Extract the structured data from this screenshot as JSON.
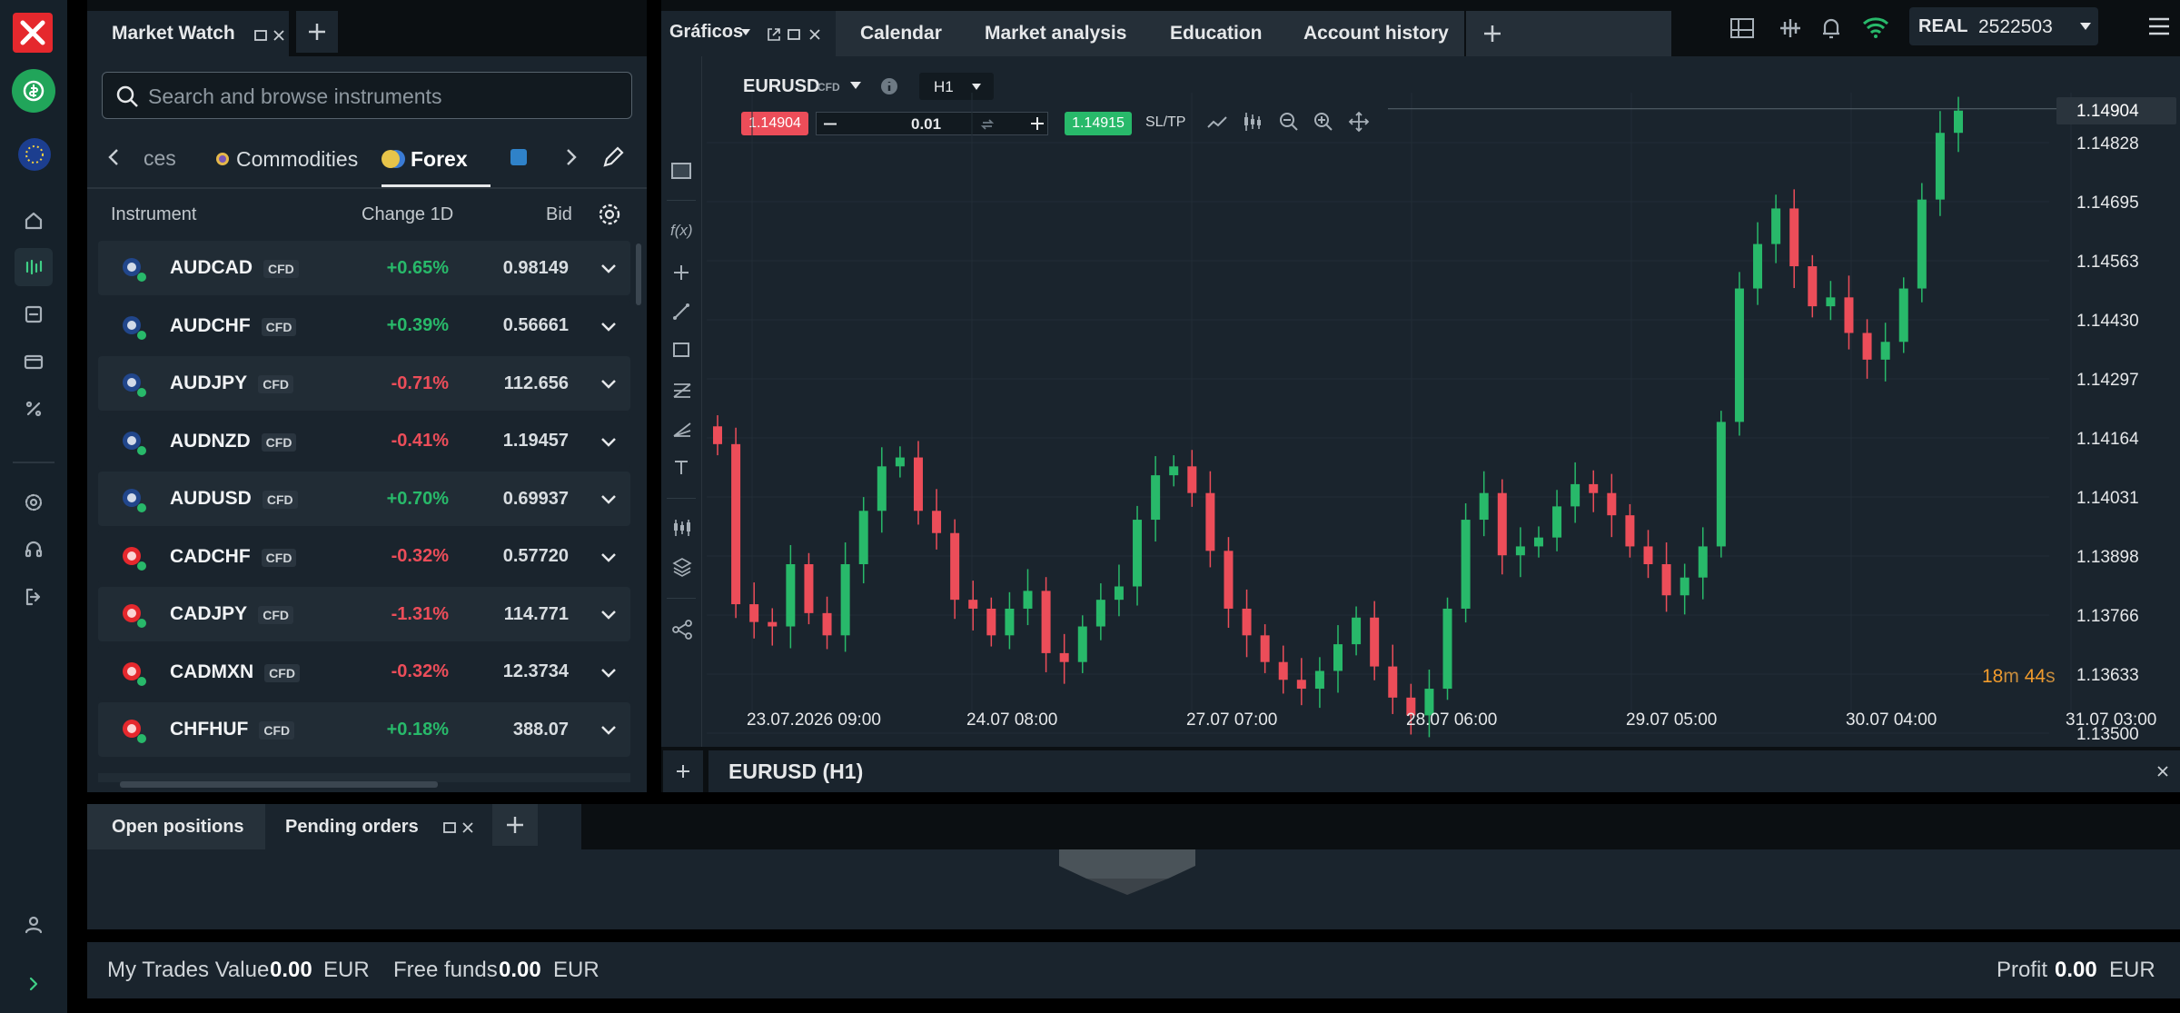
{
  "market_watch": {
    "title": "Market Watch",
    "search_placeholder": "Search and browse instruments",
    "categories": [
      {
        "label": "ces"
      },
      {
        "label": "Commodities"
      },
      {
        "label": "Forex"
      }
    ],
    "columns": {
      "instrument": "Instrument",
      "change": "Change 1D",
      "bid": "Bid"
    },
    "rows": [
      {
        "symbol": "AUDCAD",
        "badge": "CFD",
        "change": "+0.65%",
        "bid": "0.98149",
        "dir": "up"
      },
      {
        "symbol": "AUDCHF",
        "badge": "CFD",
        "change": "+0.39%",
        "bid": "0.56661",
        "dir": "up"
      },
      {
        "symbol": "AUDJPY",
        "badge": "CFD",
        "change": "-0.71%",
        "bid": "112.656",
        "dir": "down"
      },
      {
        "symbol": "AUDNZD",
        "badge": "CFD",
        "change": "-0.41%",
        "bid": "1.19457",
        "dir": "down"
      },
      {
        "symbol": "AUDUSD",
        "badge": "CFD",
        "change": "+0.70%",
        "bid": "0.69937",
        "dir": "up"
      },
      {
        "symbol": "CADCHF",
        "badge": "CFD",
        "change": "-0.32%",
        "bid": "0.57720",
        "dir": "down"
      },
      {
        "symbol": "CADJPY",
        "badge": "CFD",
        "change": "-1.31%",
        "bid": "114.771",
        "dir": "down"
      },
      {
        "symbol": "CADMXN",
        "badge": "CFD",
        "change": "-0.32%",
        "bid": "12.3734",
        "dir": "down"
      },
      {
        "symbol": "CHFHUF",
        "badge": "CFD",
        "change": "+0.18%",
        "bid": "388.07",
        "dir": "up"
      }
    ]
  },
  "top_tabs": {
    "charts": "Gráficos",
    "calendar": "Calendar",
    "analysis": "Market analysis",
    "education": "Education",
    "history": "Account history"
  },
  "account": {
    "type": "REAL",
    "number": "2522503"
  },
  "chart": {
    "symbol": "EURUSD",
    "badge": "CFD",
    "timeframe": "H1",
    "sell_price": "1.14904",
    "volume": "0.01",
    "buy_price": "1.14915",
    "sltp": "SL/TP",
    "y_ticks": [
      "1.14828",
      "1.14695",
      "1.14563",
      "1.14430",
      "1.14297",
      "1.14164",
      "1.14031",
      "1.13898",
      "1.13766",
      "1.13633",
      "1.13500"
    ],
    "x_ticks": [
      "23.07.2026 09:00",
      "24.07 08:00",
      "27.07 07:00",
      "28.07 06:00",
      "29.07 05:00",
      "30.07 04:00",
      "31.07 03:00"
    ],
    "current_price": "1.14904",
    "countdown": {
      "min": "18",
      "min_unit": "m",
      "sec": "44",
      "sec_unit": "s"
    },
    "footer_title": "EURUSD (H1)"
  },
  "chart_data": {
    "type": "candlestick",
    "title": "EURUSD (H1)",
    "ylim": [
      1.135,
      1.14904
    ],
    "x": [
      "23.07.2026 09:00",
      "24.07 08:00",
      "27.07 07:00",
      "28.07 06:00",
      "29.07 05:00",
      "30.07 04:00",
      "31.07 03:00"
    ],
    "close": [
      1.1415,
      1.1379,
      1.1375,
      1.1374,
      1.1388,
      1.1377,
      1.1372,
      1.1388,
      1.14,
      1.141,
      1.1412,
      1.14,
      1.1395,
      1.138,
      1.1378,
      1.1372,
      1.1378,
      1.1382,
      1.1368,
      1.1366,
      1.1374,
      1.138,
      1.1383,
      1.1398,
      1.1408,
      1.141,
      1.1404,
      1.1391,
      1.1378,
      1.1372,
      1.1366,
      1.1362,
      1.136,
      1.1364,
      1.137,
      1.1376,
      1.1365,
      1.1358,
      1.1354,
      1.136,
      1.1378,
      1.1398,
      1.1404,
      1.139,
      1.1392,
      1.1394,
      1.1401,
      1.1406,
      1.1404,
      1.1399,
      1.1392,
      1.1388,
      1.1381,
      1.1385,
      1.1392,
      1.142,
      1.145,
      1.146,
      1.1468,
      1.1455,
      1.1446,
      1.1448,
      1.144,
      1.1434,
      1.1438,
      1.145,
      1.147,
      1.1485,
      1.149
    ],
    "low_high_note": "",
    "current_price": 1.14904
  },
  "bottom_tabs": {
    "open": "Open positions",
    "pending": "Pending orders"
  },
  "footer": {
    "trades_label": "My Trades Value",
    "trades_value": "0.00",
    "trades_ccy": "EUR",
    "funds_label": "Free funds",
    "funds_value": "0.00",
    "funds_ccy": "EUR",
    "profit_label": "Profit",
    "profit_value": "0.00",
    "profit_ccy": "EUR"
  },
  "colors": {
    "up": "#28b96a",
    "down": "#ec4d59",
    "accent": "#e5282d",
    "panel": "#1a242d",
    "countdown": "#f19b2c"
  }
}
